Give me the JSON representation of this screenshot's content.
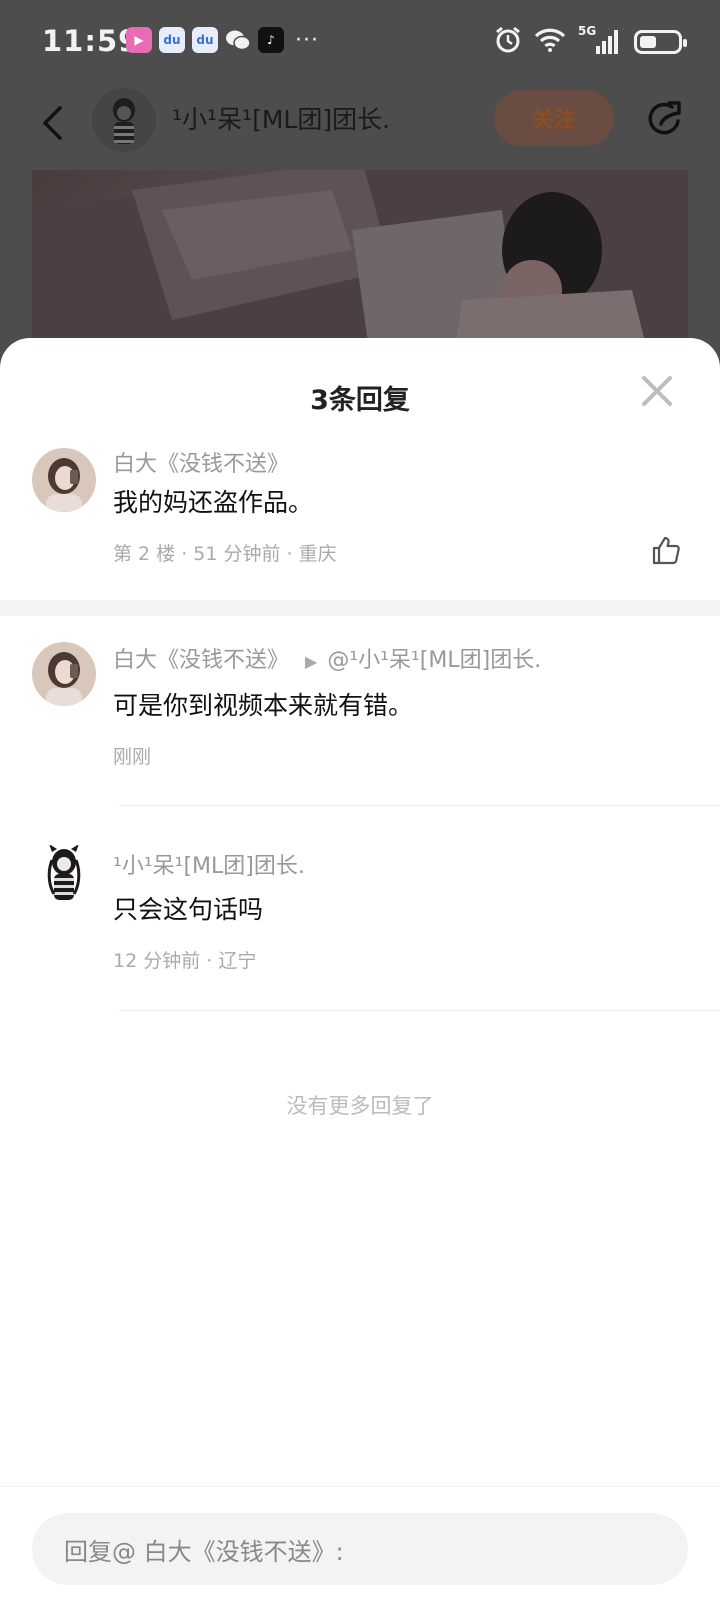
{
  "status_bar": {
    "time": "11:59",
    "notification_icons": [
      "bilibili-video-icon",
      "baidu-icon",
      "baidu-icon",
      "wechat-icon",
      "tiktok-icon"
    ],
    "more": "···",
    "network": "5G",
    "battery_level": 0.45
  },
  "top_bar": {
    "author_name": "¹小¹呆¹[ML团]团长.",
    "follow_label": "关注"
  },
  "sheet": {
    "title": "3条回复",
    "root_comment": {
      "author": "白大《没钱不送》",
      "text": "我的妈还盗作品。",
      "meta": "第 2 楼 · 51 分钟前 · 重庆"
    },
    "replies": [
      {
        "author": "白大《没钱不送》",
        "reply_to": "@¹小¹呆¹[ML团]团长.",
        "text": "可是你到视频本来就有错。",
        "meta": "刚刚"
      },
      {
        "author": "¹小¹呆¹[ML团]团长.",
        "text": "只会这句话吗",
        "meta": "12 分钟前 · 辽宁"
      }
    ],
    "no_more": "没有更多回复了"
  },
  "input": {
    "placeholder": "回复@ 白大《没钱不送》:"
  },
  "colors": {
    "overlay": "#4d4d4d",
    "follow_accent": "#8a4e22",
    "muted_text": "#999999"
  }
}
